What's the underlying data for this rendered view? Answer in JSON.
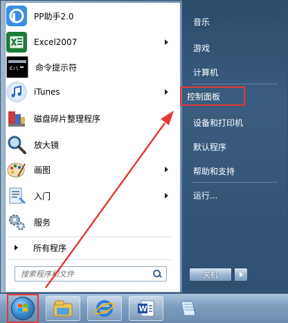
{
  "programs": [
    {
      "label": "PP助手2.0",
      "icon": "pp-assistant-icon",
      "has_submenu": false
    },
    {
      "label": "Excel2007",
      "icon": "excel-icon",
      "has_submenu": true
    },
    {
      "label": "命令提示符",
      "icon": "command-prompt-icon",
      "has_submenu": false
    },
    {
      "label": "iTunes",
      "icon": "itunes-icon",
      "has_submenu": true
    },
    {
      "label": "磁盘碎片整理程序",
      "icon": "disk-defragmenter-icon",
      "has_submenu": false
    },
    {
      "label": "放大镜",
      "icon": "magnifier-icon",
      "has_submenu": false
    },
    {
      "label": "画图",
      "icon": "paint-icon",
      "has_submenu": true
    },
    {
      "label": "入门",
      "icon": "getting-started-icon",
      "has_submenu": true
    },
    {
      "label": "服务",
      "icon": "services-icon",
      "has_submenu": false
    }
  ],
  "all_programs_label": "所有程序",
  "search": {
    "placeholder": "搜索程序和文件"
  },
  "right_items": [
    {
      "label": "音乐"
    },
    {
      "label": "游戏"
    },
    {
      "label": "计算机"
    },
    {
      "label": "控制面板",
      "highlighted": true
    },
    {
      "label": "设备和打印机"
    },
    {
      "label": "默认程序"
    },
    {
      "label": "帮助和支持"
    },
    {
      "label": "运行..."
    }
  ],
  "shutdown": {
    "label": "关机"
  },
  "taskbar": {
    "items": [
      {
        "icon": "windows-explorer-icon"
      },
      {
        "icon": "internet-explorer-icon"
      },
      {
        "icon": "word-icon"
      },
      {
        "icon": "notepad-icon"
      }
    ]
  },
  "colors": {
    "highlight": "#e53935",
    "right_panel": "#2c4a6b",
    "taskbar": "#7f9ec0"
  }
}
